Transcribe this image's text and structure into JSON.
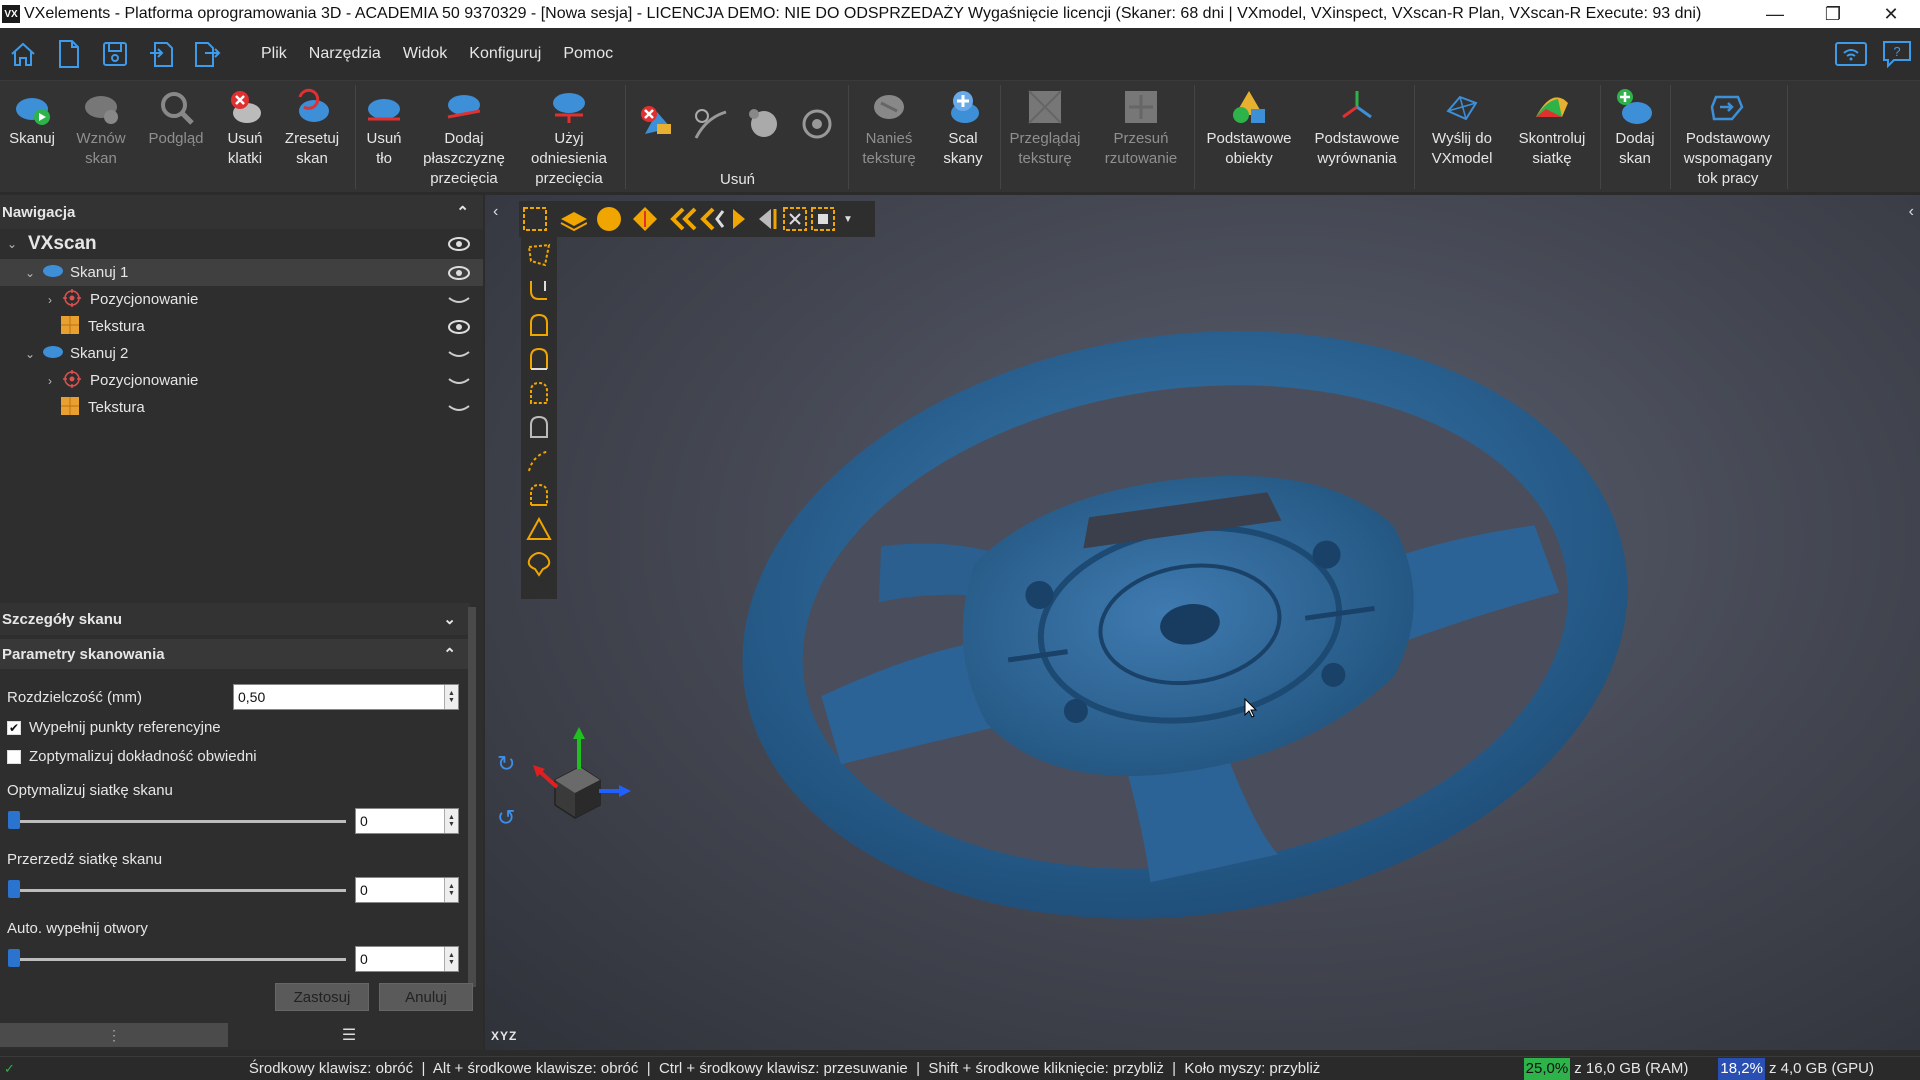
{
  "window": {
    "title": "VXelements - Platforma oprogramowania 3D - ACADEMIA 50 9370329 - [Nowa sesja] - LICENCJA DEMO: NIE DO ODSPRZEDAŻY Wygaśnięcie licencji (Skaner: 68 dni | VXmodel, VXinspect, VXscan-R Plan, VXscan-R Execute: 93 dni)",
    "logo": "VX",
    "minimize": "—",
    "maximize": "❐",
    "close": "✕"
  },
  "menu": [
    "Plik",
    "Narzędzia",
    "Widok",
    "Konfiguruj",
    "Pomoc"
  ],
  "quick_icons": [
    "home-icon",
    "new-file-icon",
    "save-icon",
    "import-icon",
    "export-icon"
  ],
  "ribbon": {
    "buttons": [
      {
        "label": "Skanuj",
        "icon": "scan-icon",
        "enabled": true
      },
      {
        "label": "Wznów\nskan",
        "icon": "resume-scan-icon",
        "enabled": false
      },
      {
        "label": "Podgląd",
        "icon": "preview-icon",
        "enabled": false
      },
      {
        "label": "Usuń\nklatki",
        "icon": "delete-frames-icon",
        "enabled": true
      },
      {
        "label": "Zresetuj\nskan",
        "icon": "reset-scan-icon",
        "enabled": true
      },
      {
        "label": "Usuń\ntło",
        "icon": "remove-background-icon",
        "enabled": true
      },
      {
        "label": "Dodaj\npłaszczyznę\nprzecięcia",
        "icon": "add-clipping-plane-icon",
        "enabled": true
      },
      {
        "label": "Użyj\nodniesienia\nprzecięcia",
        "icon": "use-clipping-reference-icon",
        "enabled": true
      },
      {
        "label": "Nanieś\nteksturę",
        "icon": "apply-texture-icon",
        "enabled": false
      },
      {
        "label": "Scal\nskany",
        "icon": "merge-scans-icon",
        "enabled": true
      },
      {
        "label": "Przeglądaj\nteksturę",
        "icon": "browse-texture-icon",
        "enabled": false
      },
      {
        "label": "Przesuń\nrzutowanie",
        "icon": "move-projection-icon",
        "enabled": false
      },
      {
        "label": "Podstawowe\nobiekty",
        "icon": "basic-entities-icon",
        "enabled": true
      },
      {
        "label": "Podstawowe\nwyrównania",
        "icon": "basic-alignments-icon",
        "enabled": true
      },
      {
        "label": "Wyślij do\nVXmodel",
        "icon": "send-to-vxmodel-icon",
        "enabled": true
      },
      {
        "label": "Skontroluj\nsiatkę",
        "icon": "inspect-mesh-icon",
        "enabled": true
      },
      {
        "label": "Dodaj\nskan",
        "icon": "add-scan-icon",
        "enabled": true
      },
      {
        "label": "Podstawowy\nwspomagany\ntok pracy",
        "icon": "guided-workflow-icon",
        "enabled": true
      }
    ],
    "delete_group_label": "Usuń"
  },
  "navigation": {
    "header": "Nawigacja",
    "root": "VXscan",
    "items": [
      {
        "label": "Skanuj 1",
        "level": 1,
        "type": "scan",
        "expanded": true,
        "visible": true,
        "selected": true
      },
      {
        "label": "Pozycjonowanie",
        "level": 2,
        "type": "positioning",
        "expanded": false,
        "visible": false
      },
      {
        "label": "Tekstura",
        "level": 2,
        "type": "texture",
        "visible": true
      },
      {
        "label": "Skanuj 2",
        "level": 1,
        "type": "scan",
        "expanded": true,
        "visible": false
      },
      {
        "label": "Pozycjonowanie",
        "level": 2,
        "type": "positioning",
        "expanded": false,
        "visible": false
      },
      {
        "label": "Tekstura",
        "level": 2,
        "type": "texture",
        "visible": false
      }
    ]
  },
  "scan_details": {
    "header": "Szczegóły skanu",
    "params_header": "Parametry skanowania",
    "resolution_label": "Rozdzielczość (mm)",
    "resolution_value": "0,50",
    "fill_targets_label": "Wypełnij punkty referencyjne",
    "fill_targets_checked": true,
    "optimize_envelope_label": "Zoptymalizuj dokładność obwiedni",
    "optimize_envelope_checked": false,
    "optimize_mesh_label": "Optymalizuj siatkę skanu",
    "optimize_mesh_value": "0",
    "decimate_label": "Przerzedź siatkę skanu",
    "decimate_value": "0",
    "fill_holes_label": "Auto. wypełnij otwory",
    "fill_holes_value": "0",
    "apply_button": "Zastosuj",
    "cancel_button": "Anuluj"
  },
  "viewport": {
    "axis_label": "XYZ",
    "colors": {
      "model": "#2f6a9a",
      "axis_x": "#e02020",
      "axis_y": "#20c020",
      "axis_z": "#2060ff",
      "accent": "#2a74d0"
    }
  },
  "status": {
    "hints": "Środkowy klawisz: obróć  |  Alt + środkowe klawisze: obróć  |  Ctrl + środkowy klawisz: przesuwanie  |  Shift + środkowe kliknięcie: przybliż  |  Koło myszy: przybliż",
    "ram_percent": "25,0%",
    "ram_text": "z 16,0 GB (RAM)",
    "gpu_percent": "18,2%",
    "gpu_text": "z 4,0 GB (GPU)",
    "ram_color": "#2db34a",
    "gpu_color": "#2a4fb3"
  }
}
